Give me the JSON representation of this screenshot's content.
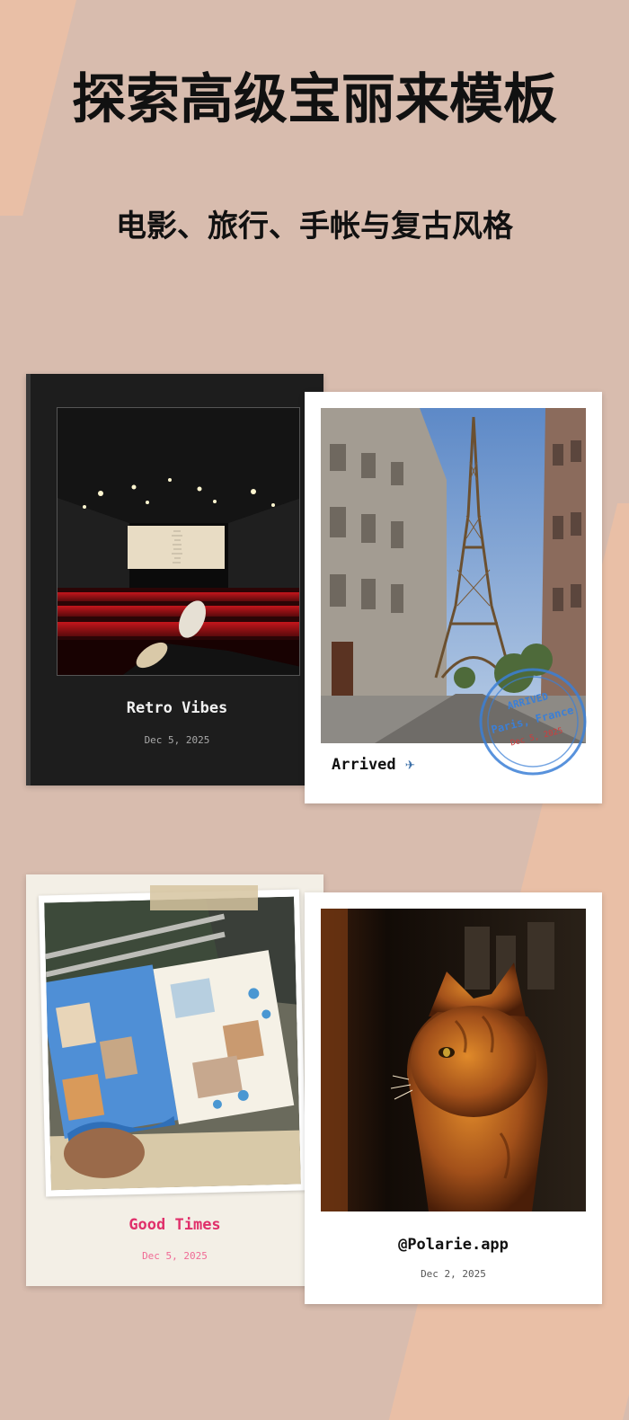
{
  "header": {
    "title": "探索高级宝丽来模板",
    "subtitle": "电影、旅行、手帐与复古风格"
  },
  "cards": [
    {
      "title": "Retro Vibes",
      "date": "Dec 5, 2025",
      "photo": "cinema-photo"
    },
    {
      "caption": "Arrived",
      "icon": "airplane-icon",
      "photo": "eiffel-tower-photo",
      "stamp": {
        "line1": "ARRIVED",
        "line2": "Paris, France",
        "line3": "Dec 5, 2025"
      }
    },
    {
      "title": "Good Times",
      "date": "Dec 5, 2025",
      "photo": "scrapbook-journal-photo"
    },
    {
      "title": "@Polarie.app",
      "date": "Dec 2, 2025",
      "photo": "cat-photo"
    }
  ],
  "colors": {
    "background": "#d8bcae",
    "accent_stripe": "#e9bfa6",
    "journal_title": "#e0306b",
    "stamp_blue": "#3b7fd6"
  }
}
